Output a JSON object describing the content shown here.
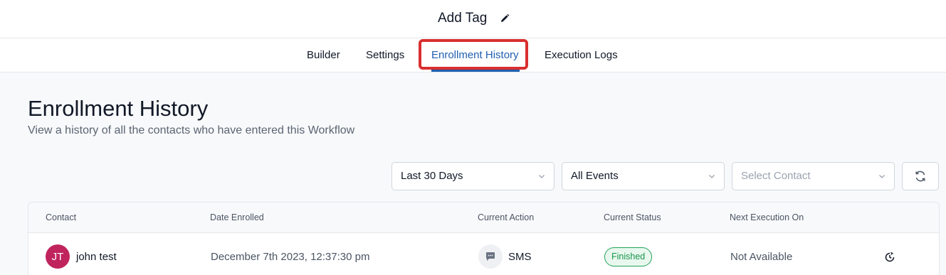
{
  "header": {
    "title": "Add Tag",
    "edit_icon": "pencil-icon"
  },
  "tabs": [
    {
      "label": "Builder",
      "active": false
    },
    {
      "label": "Settings",
      "active": false
    },
    {
      "label": "Enrollment History",
      "active": true
    },
    {
      "label": "Execution Logs",
      "active": false
    }
  ],
  "page": {
    "title": "Enrollment History",
    "subtitle": "View a history of all the contacts who have entered this Workflow"
  },
  "filters": {
    "date_range": "Last 30 Days",
    "events": "All Events",
    "contact_placeholder": "Select Contact",
    "refresh_icon": "refresh-icon"
  },
  "table": {
    "columns": [
      "Contact",
      "Date Enrolled",
      "Current Action",
      "Current Status",
      "Next Execution On"
    ],
    "rows": [
      {
        "avatar_initials": "JT",
        "contact": "john test",
        "date_enrolled": "December 7th 2023, 12:37:30 pm",
        "action_icon": "message-icon",
        "current_action": "SMS",
        "status": "Finished",
        "next_execution": "Not Available",
        "history_icon": "history-icon"
      }
    ]
  },
  "colors": {
    "accent": "#1f5fb0",
    "highlight": "#d92f2f",
    "avatar": "#c0245c",
    "status_success": "#22a35a"
  }
}
